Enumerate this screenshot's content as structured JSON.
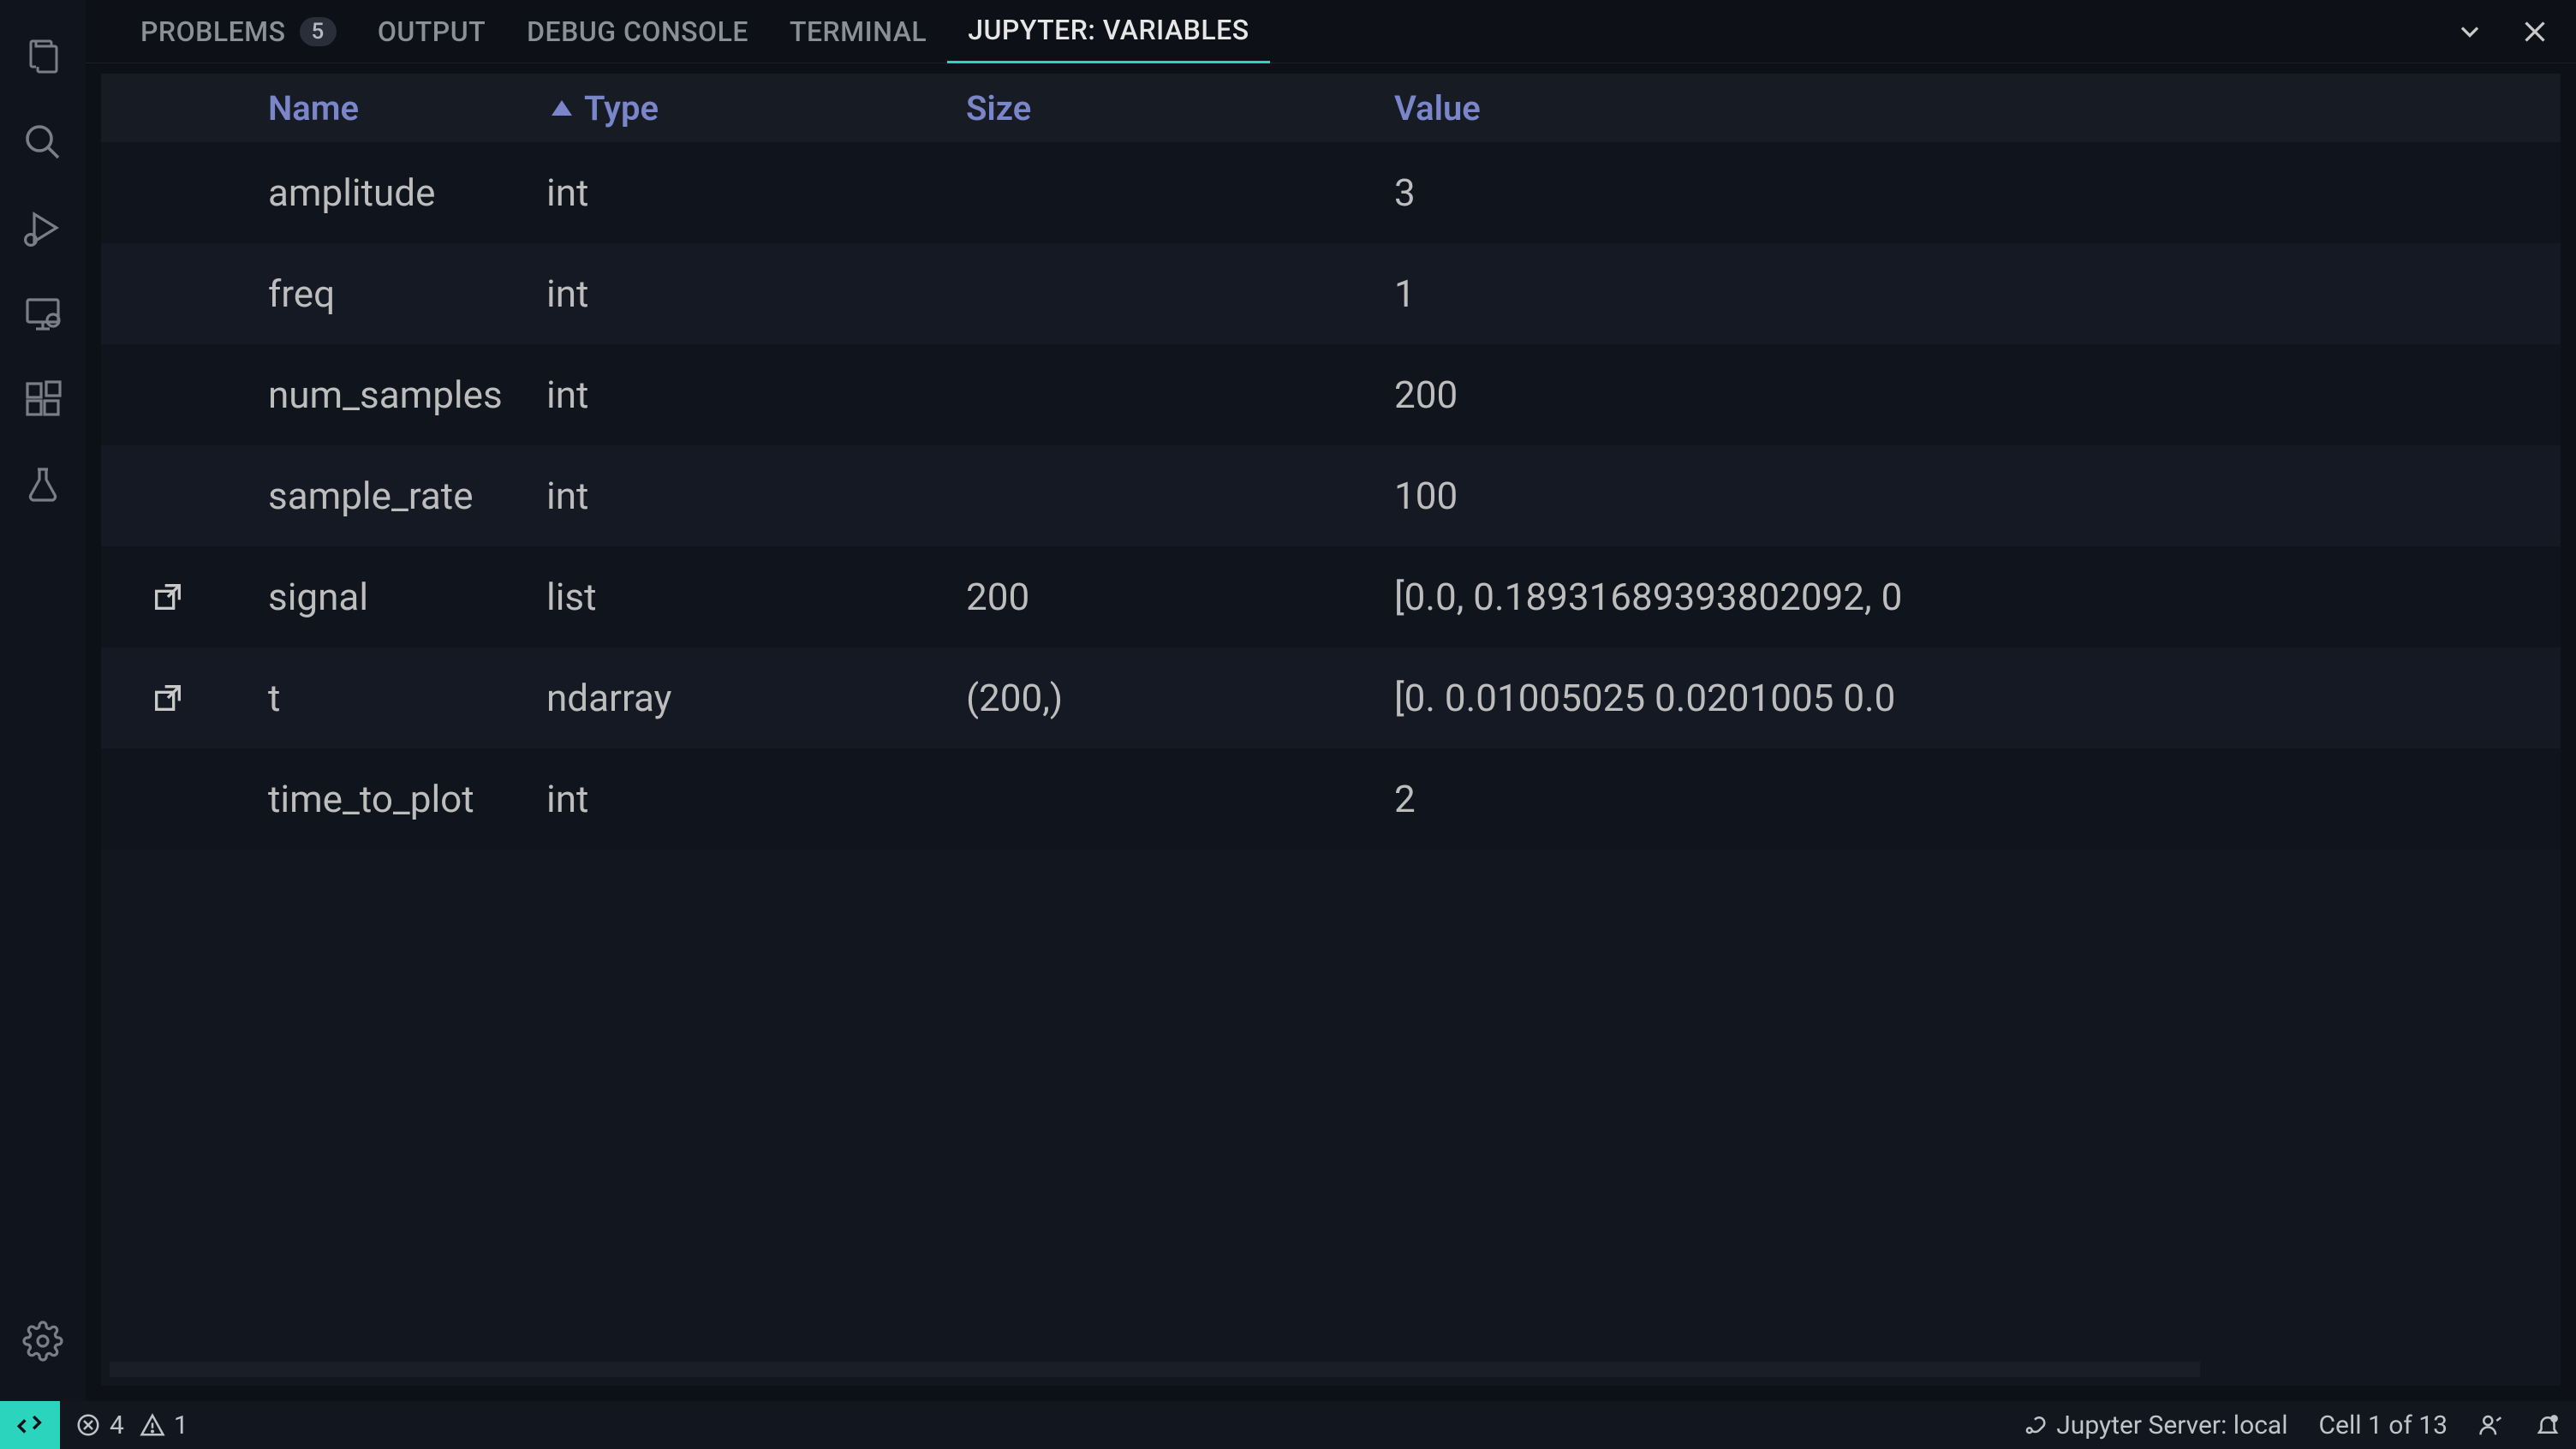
{
  "tabs": {
    "problems": {
      "label": "PROBLEMS",
      "badge": "5"
    },
    "output": {
      "label": "OUTPUT"
    },
    "debug_console": {
      "label": "DEBUG CONSOLE"
    },
    "terminal": {
      "label": "TERMINAL"
    },
    "jupyter_variables": {
      "label": "JUPYTER: VARIABLES"
    }
  },
  "columns": {
    "name": "Name",
    "type": "Type",
    "size": "Size",
    "value": "Value"
  },
  "variables": [
    {
      "name": "amplitude",
      "type": "int",
      "size": "",
      "value": "3",
      "expandable": false
    },
    {
      "name": "freq",
      "type": "int",
      "size": "",
      "value": "1",
      "expandable": false
    },
    {
      "name": "num_samples",
      "type": "int",
      "size": "",
      "value": "200",
      "expandable": false
    },
    {
      "name": "sample_rate",
      "type": "int",
      "size": "",
      "value": "100",
      "expandable": false
    },
    {
      "name": "signal",
      "type": "list",
      "size": "200",
      "value": "[0.0, 0.18931689393802092, 0",
      "expandable": true
    },
    {
      "name": "t",
      "type": "ndarray",
      "size": "(200,)",
      "value": "[0. 0.01005025 0.0201005 0.0",
      "expandable": true
    },
    {
      "name": "time_to_plot",
      "type": "int",
      "size": "",
      "value": "2",
      "expandable": false
    }
  ],
  "status": {
    "errors": "4",
    "warnings": "1",
    "jupyter_server": "Jupyter Server: local",
    "cell_position": "Cell 1 of 13"
  }
}
